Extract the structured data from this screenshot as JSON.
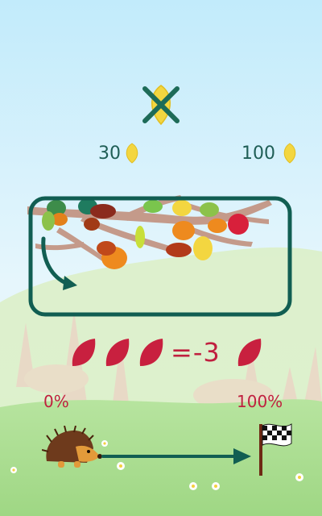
{
  "goal": {
    "icon": "golden-leaf-crossed-icon",
    "left_value": "30",
    "right_value": "100",
    "left_icon": "golden-leaf-icon",
    "right_icon": "golden-leaf-icon"
  },
  "tree_panel": {
    "frame_color": "#115e52",
    "arrow": "curved-arrow-icon"
  },
  "equation": {
    "leaf_count": 3,
    "text": "=-3",
    "leaf_icon": "red-leaf-icon",
    "color": "#c0203f"
  },
  "progress": {
    "start_label": "0%",
    "end_label": "100%",
    "runner_icon": "hedgehog-icon",
    "finish_icon": "checkered-flag-icon",
    "progress_fraction": 0.0
  },
  "colors": {
    "sky": "#cdeefa",
    "hill": "#cfe8b4",
    "grass": "#a6dd8c",
    "accent_green": "#115e52",
    "accent_red": "#c0203f",
    "gold": "#f3d640"
  }
}
